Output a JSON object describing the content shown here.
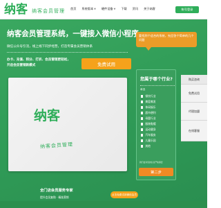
{
  "header": {
    "logo": "纳客",
    "slogan": "纳客会员管理",
    "nav": [
      {
        "label": "首页",
        "caret": false
      },
      {
        "label": "系统版本",
        "caret": true
      },
      {
        "label": "硬件设备",
        "caret": true
      },
      {
        "label": "下载",
        "caret": false
      },
      {
        "label": "资讯",
        "caret": false
      },
      {
        "label": "关于纳客",
        "caret": false
      }
    ],
    "login_label": "帐号登录"
  },
  "hero": {
    "title": "纳客会员管理系统，一键接入微信小程序",
    "subtitle": "微信公众号引流，线上线下同步经营，打造专属会员营销体系",
    "features": [
      "办卡、充值、积分、打折、会员管理更轻松，",
      "开启会员营销新模式"
    ],
    "trial_label": "免费试用"
  },
  "card": {
    "logo": "纳客",
    "slogan": "纳客会员管理"
  },
  "bubble": {
    "text": "要找到个适合的系统，先回答个简单的几个问题"
  },
  "survey": {
    "title": "您属于哪个行业?",
    "hint": "单选",
    "options": [
      "餐饮行业",
      "美容美发",
      "休闲娱乐",
      "超市便利",
      "母婴行业",
      "服装鞋帽",
      "运动健身",
      "汽车服务",
      "儿童乐园",
      "其他"
    ],
    "note": "我们会对您的信息严格保密",
    "step_label": "第二步"
  },
  "side_tabs": [
    "购买咨询",
    "免费试用",
    "代理加盟",
    "在线客服"
  ],
  "bottom": {
    "title": "全门店会员服务专家",
    "tags": "提升会员复购 · 精准营销",
    "cta_label": "点击免费试用微信会员"
  }
}
